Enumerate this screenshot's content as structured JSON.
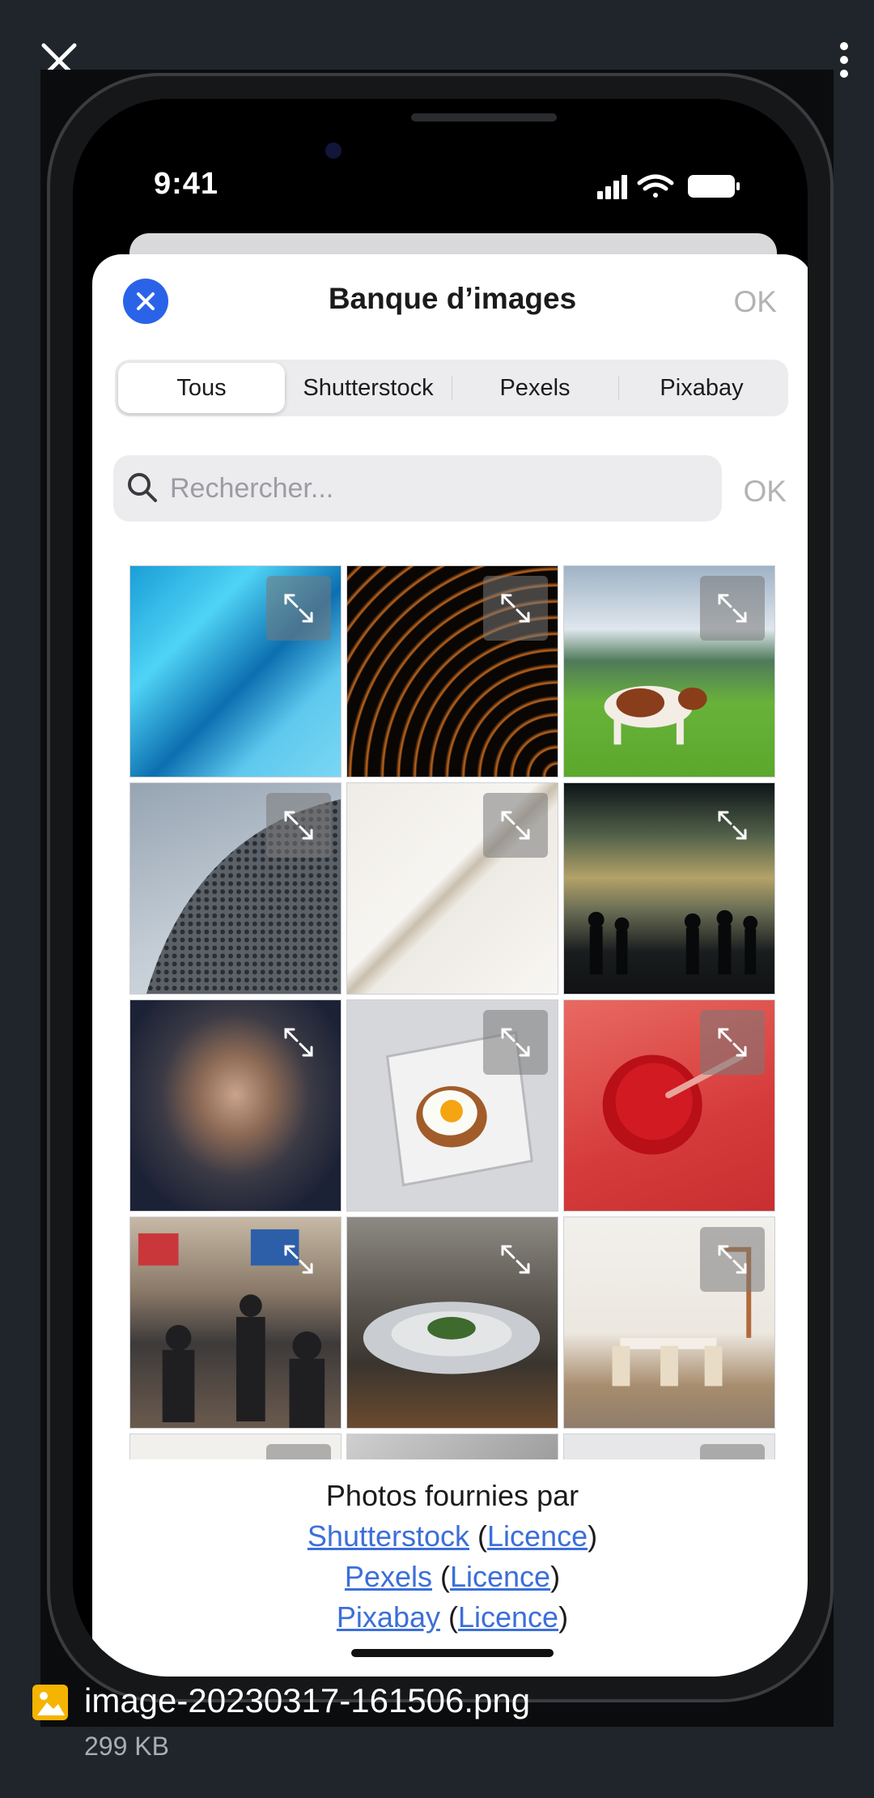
{
  "viewer": {
    "close_icon": "close-icon",
    "menu_icon": "more-vertical-icon",
    "file_name": "image-20230317-161506.png",
    "file_size": "299 KB",
    "file_icon": "image-file-icon"
  },
  "phone": {
    "status_time": "9:41",
    "status_icons": [
      "signal-icon",
      "wifi-icon",
      "battery-icon"
    ]
  },
  "sheet": {
    "title": "Banque d’images",
    "ok_label": "OK",
    "close_icon": "close-icon",
    "accent_color": "#2a63e8"
  },
  "tabs": [
    {
      "label": "Tous",
      "active": true
    },
    {
      "label": "Shutterstock",
      "active": false
    },
    {
      "label": "Pexels",
      "active": false
    },
    {
      "label": "Pixabay",
      "active": false
    }
  ],
  "search": {
    "placeholder": "Rechercher...",
    "ok_label": "OK"
  },
  "grid": {
    "expand_icon": "expand-icon",
    "tiles": [
      {
        "subject": "blue abstract layers"
      },
      {
        "subject": "orange curved lines"
      },
      {
        "subject": "cow in meadow"
      },
      {
        "subject": "perforated dome facade"
      },
      {
        "subject": "white architectural curve"
      },
      {
        "subject": "immersive art exhibition"
      },
      {
        "subject": "woman portrait"
      },
      {
        "subject": "egg on toast"
      },
      {
        "subject": "red bowl"
      },
      {
        "subject": "people in gallery"
      },
      {
        "subject": "restaurant plate"
      },
      {
        "subject": "dining room interior"
      }
    ]
  },
  "credits": {
    "intro": "Photos fournies par",
    "providers": [
      {
        "name": "Shutterstock",
        "license": "Licence"
      },
      {
        "name": "Pexels",
        "license": "Licence"
      },
      {
        "name": "Pixabay",
        "license": "Licence"
      }
    ]
  }
}
